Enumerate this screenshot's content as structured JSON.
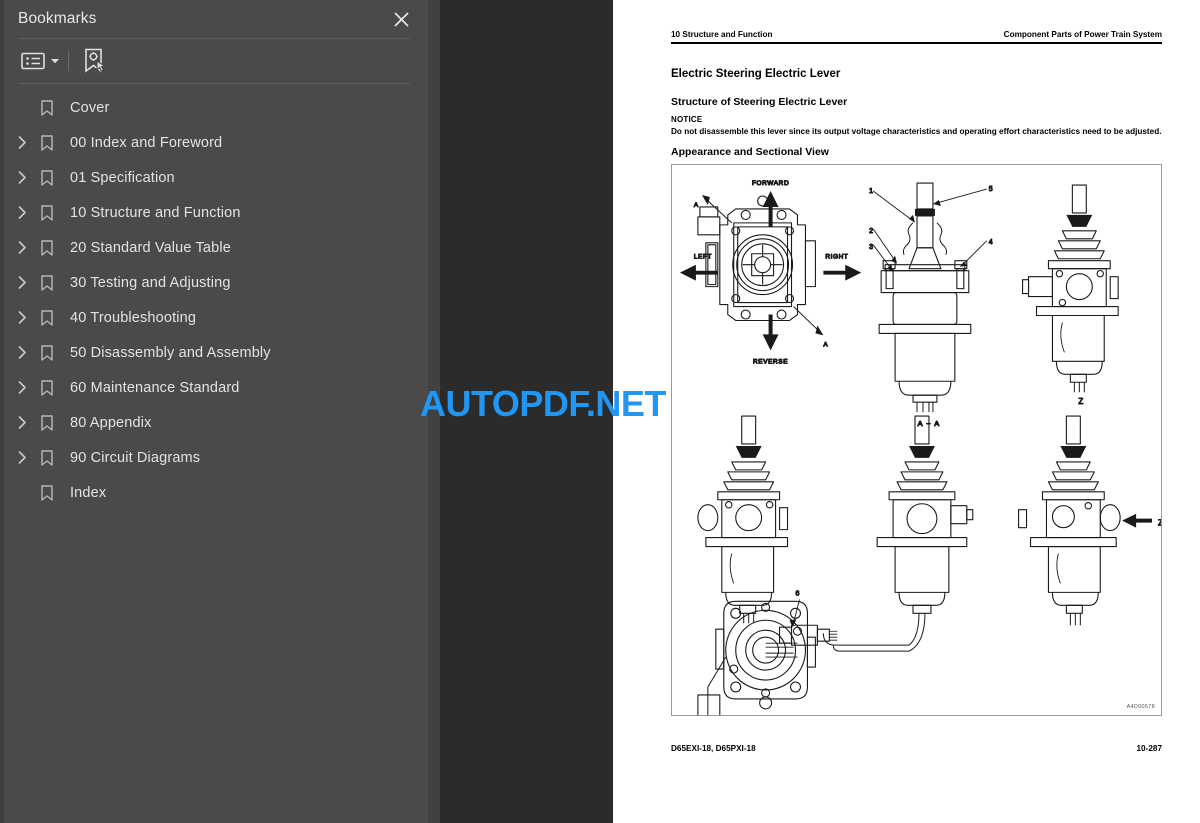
{
  "sidebar": {
    "title": "Bookmarks",
    "close_icon": "close-icon",
    "toolbar": {
      "options_icon": "list-options-icon",
      "options_caret_icon": "chevron-down-icon",
      "find_bookmark_icon": "find-bookmark-icon"
    },
    "bookmarks": [
      {
        "label": "Cover",
        "expandable": false
      },
      {
        "label": "00 Index and Foreword",
        "expandable": true
      },
      {
        "label": "01 Specification",
        "expandable": true
      },
      {
        "label": "10 Structure and Function",
        "expandable": true
      },
      {
        "label": "20 Standard Value Table",
        "expandable": true
      },
      {
        "label": "30 Testing and Adjusting",
        "expandable": true
      },
      {
        "label": "40 Troubleshooting",
        "expandable": true
      },
      {
        "label": "50 Disassembly and Assembly",
        "expandable": true
      },
      {
        "label": "60 Maintenance Standard",
        "expandable": true
      },
      {
        "label": "80 Appendix",
        "expandable": true
      },
      {
        "label": "90 Circuit Diagrams",
        "expandable": true
      },
      {
        "label": "Index",
        "expandable": false
      }
    ]
  },
  "watermark": {
    "text": "AUTOPDF.NET",
    "color": "#2196f3"
  },
  "page": {
    "header_left": "10 Structure and Function",
    "header_right": "Component Parts of Power Train System",
    "title": "Electric Steering Electric Lever",
    "section_heading": "Structure of Steering Electric Lever",
    "notice_label": "NOTICE",
    "notice_body": "Do not disassemble this lever since its output voltage characteristics and operating effort characteristics need to be adjusted.",
    "figure_heading": "Appearance and Sectional View",
    "figure": {
      "reference": "A4D00578",
      "direction_labels": {
        "forward": "FORWARD",
        "reverse": "REVERSE",
        "left": "LEFT",
        "right": "RIGHT"
      },
      "section_markers": [
        "A",
        "A"
      ],
      "section_view_label": "A - A",
      "view_labels": [
        "Z",
        "Z"
      ],
      "callouts": [
        "1",
        "2",
        "3",
        "4",
        "5",
        "6"
      ]
    },
    "footer_left": "D65EXI-18, D65PXI-18",
    "footer_right": "10-287"
  }
}
